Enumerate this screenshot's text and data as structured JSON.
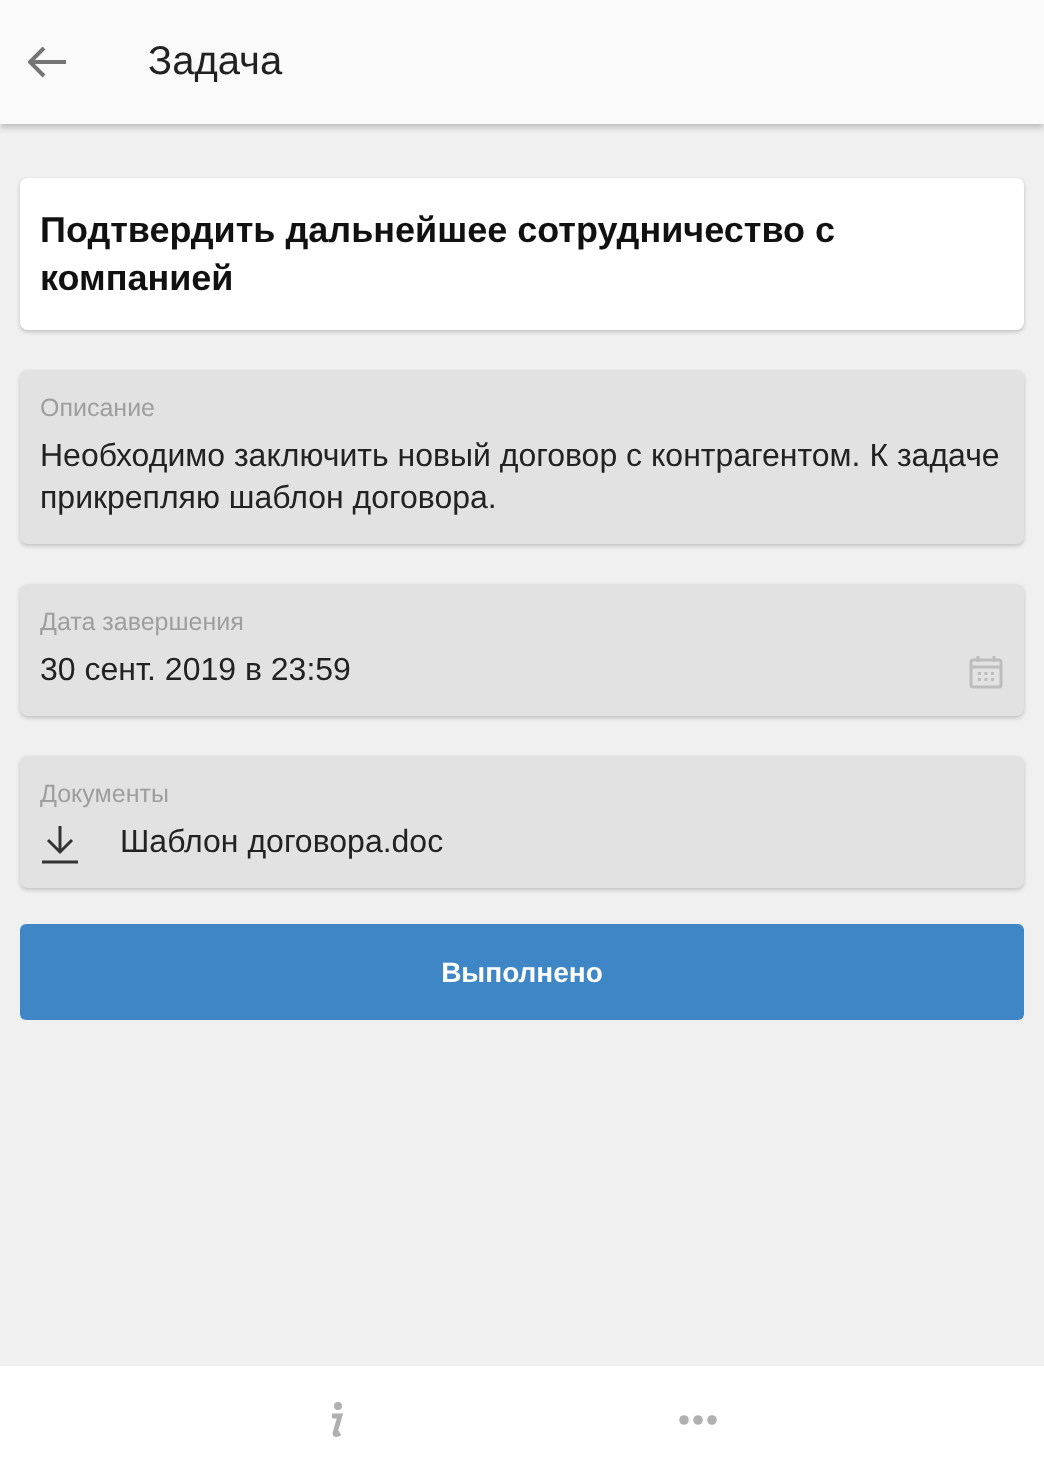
{
  "header": {
    "title": "Задача"
  },
  "task_title": "Подтвердить дальнейшее сотрудничество с компанией",
  "fields": [
    {
      "kind": "text",
      "label": "Описание",
      "value": "Необходимо заключить новый договор с контрагентом. К задаче прикрепляю шаблон договора."
    },
    {
      "kind": "date",
      "label": "Дата завершения",
      "value": "30 сент. 2019 в 23:59"
    },
    {
      "kind": "file",
      "label": "Документы",
      "value": "Шаблон договора.doc"
    }
  ],
  "action_button": "Выполнено"
}
